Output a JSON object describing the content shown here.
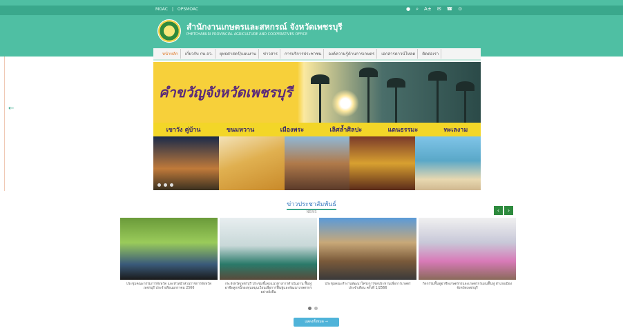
{
  "top_links": [
    "MOAC",
    "OPSMOAC"
  ],
  "top_icons": [
    "user-icon",
    "search-icon",
    "text-size-icon",
    "mail-icon",
    "phone-icon",
    "location-icon"
  ],
  "site": {
    "title": "สำนักงานเกษตรและสหกรณ์ จังหวัดเพชรบุรี",
    "subtitle": "PHETCHABURI PROVINCIAL AGRICULTURE AND COOPERATIVES OFFICE"
  },
  "nav": [
    "หน้าหลัก",
    "เกี่ยวกับ กษ.จว.",
    "ยุทธศาสตร์/แผนงาน",
    "ข่าวสาร",
    "การบริการประชาชน",
    "องค์ความรู้ด้านการเกษตร",
    "เอกสารดาวน์โหลด",
    "ติดต่อเรา"
  ],
  "hero": {
    "title": "คำขวัญจังหวัดเพชรบุรี",
    "band": [
      "เขาวัง คู่บ้าน",
      "ขนมหวาน",
      "เมืองพระ",
      "เลิศล้ำศิลปะ",
      "แดนธรรมะ",
      "ทะเลงาม"
    ]
  },
  "news": {
    "title": "ข่าวประชาสัมพันธ์",
    "subtitle": "NEWS",
    "items": [
      "ประชุมคณะกรรมการจังหวัด และหัวหน้าส่วนราชการจังหวัดเพชรบุรี ประจำเดือนมกราคม 2566",
      "กษ.จังหวัดเพชรบุรี ประชุมชี้แจงแนวทางการดำเนินงาน ฟื้นฟูอาชีพลูกหนี้กองทุนหมุนเวียนเพื่อการฟื้นฟูและพัฒนาเกษตรกรอย่างยั่งยืน",
      "ประชุมคณะทำงานพัฒนาโครงการชลประทานเพื่อการเกษตร ประจำเดือน ครั้งที่ 1/2566",
      "กิจกรรมพื้นฟูอาชีพเกษตรกรและเกษตรกรแผนฟื้นฟู อำเภอเมือง จังหวัดเพชรบุรี"
    ],
    "more": "แสดงทั้งหมด →"
  },
  "colors": {
    "header": "#4fbfa3",
    "accent": "#3aa88c",
    "band": "#f3d628"
  }
}
